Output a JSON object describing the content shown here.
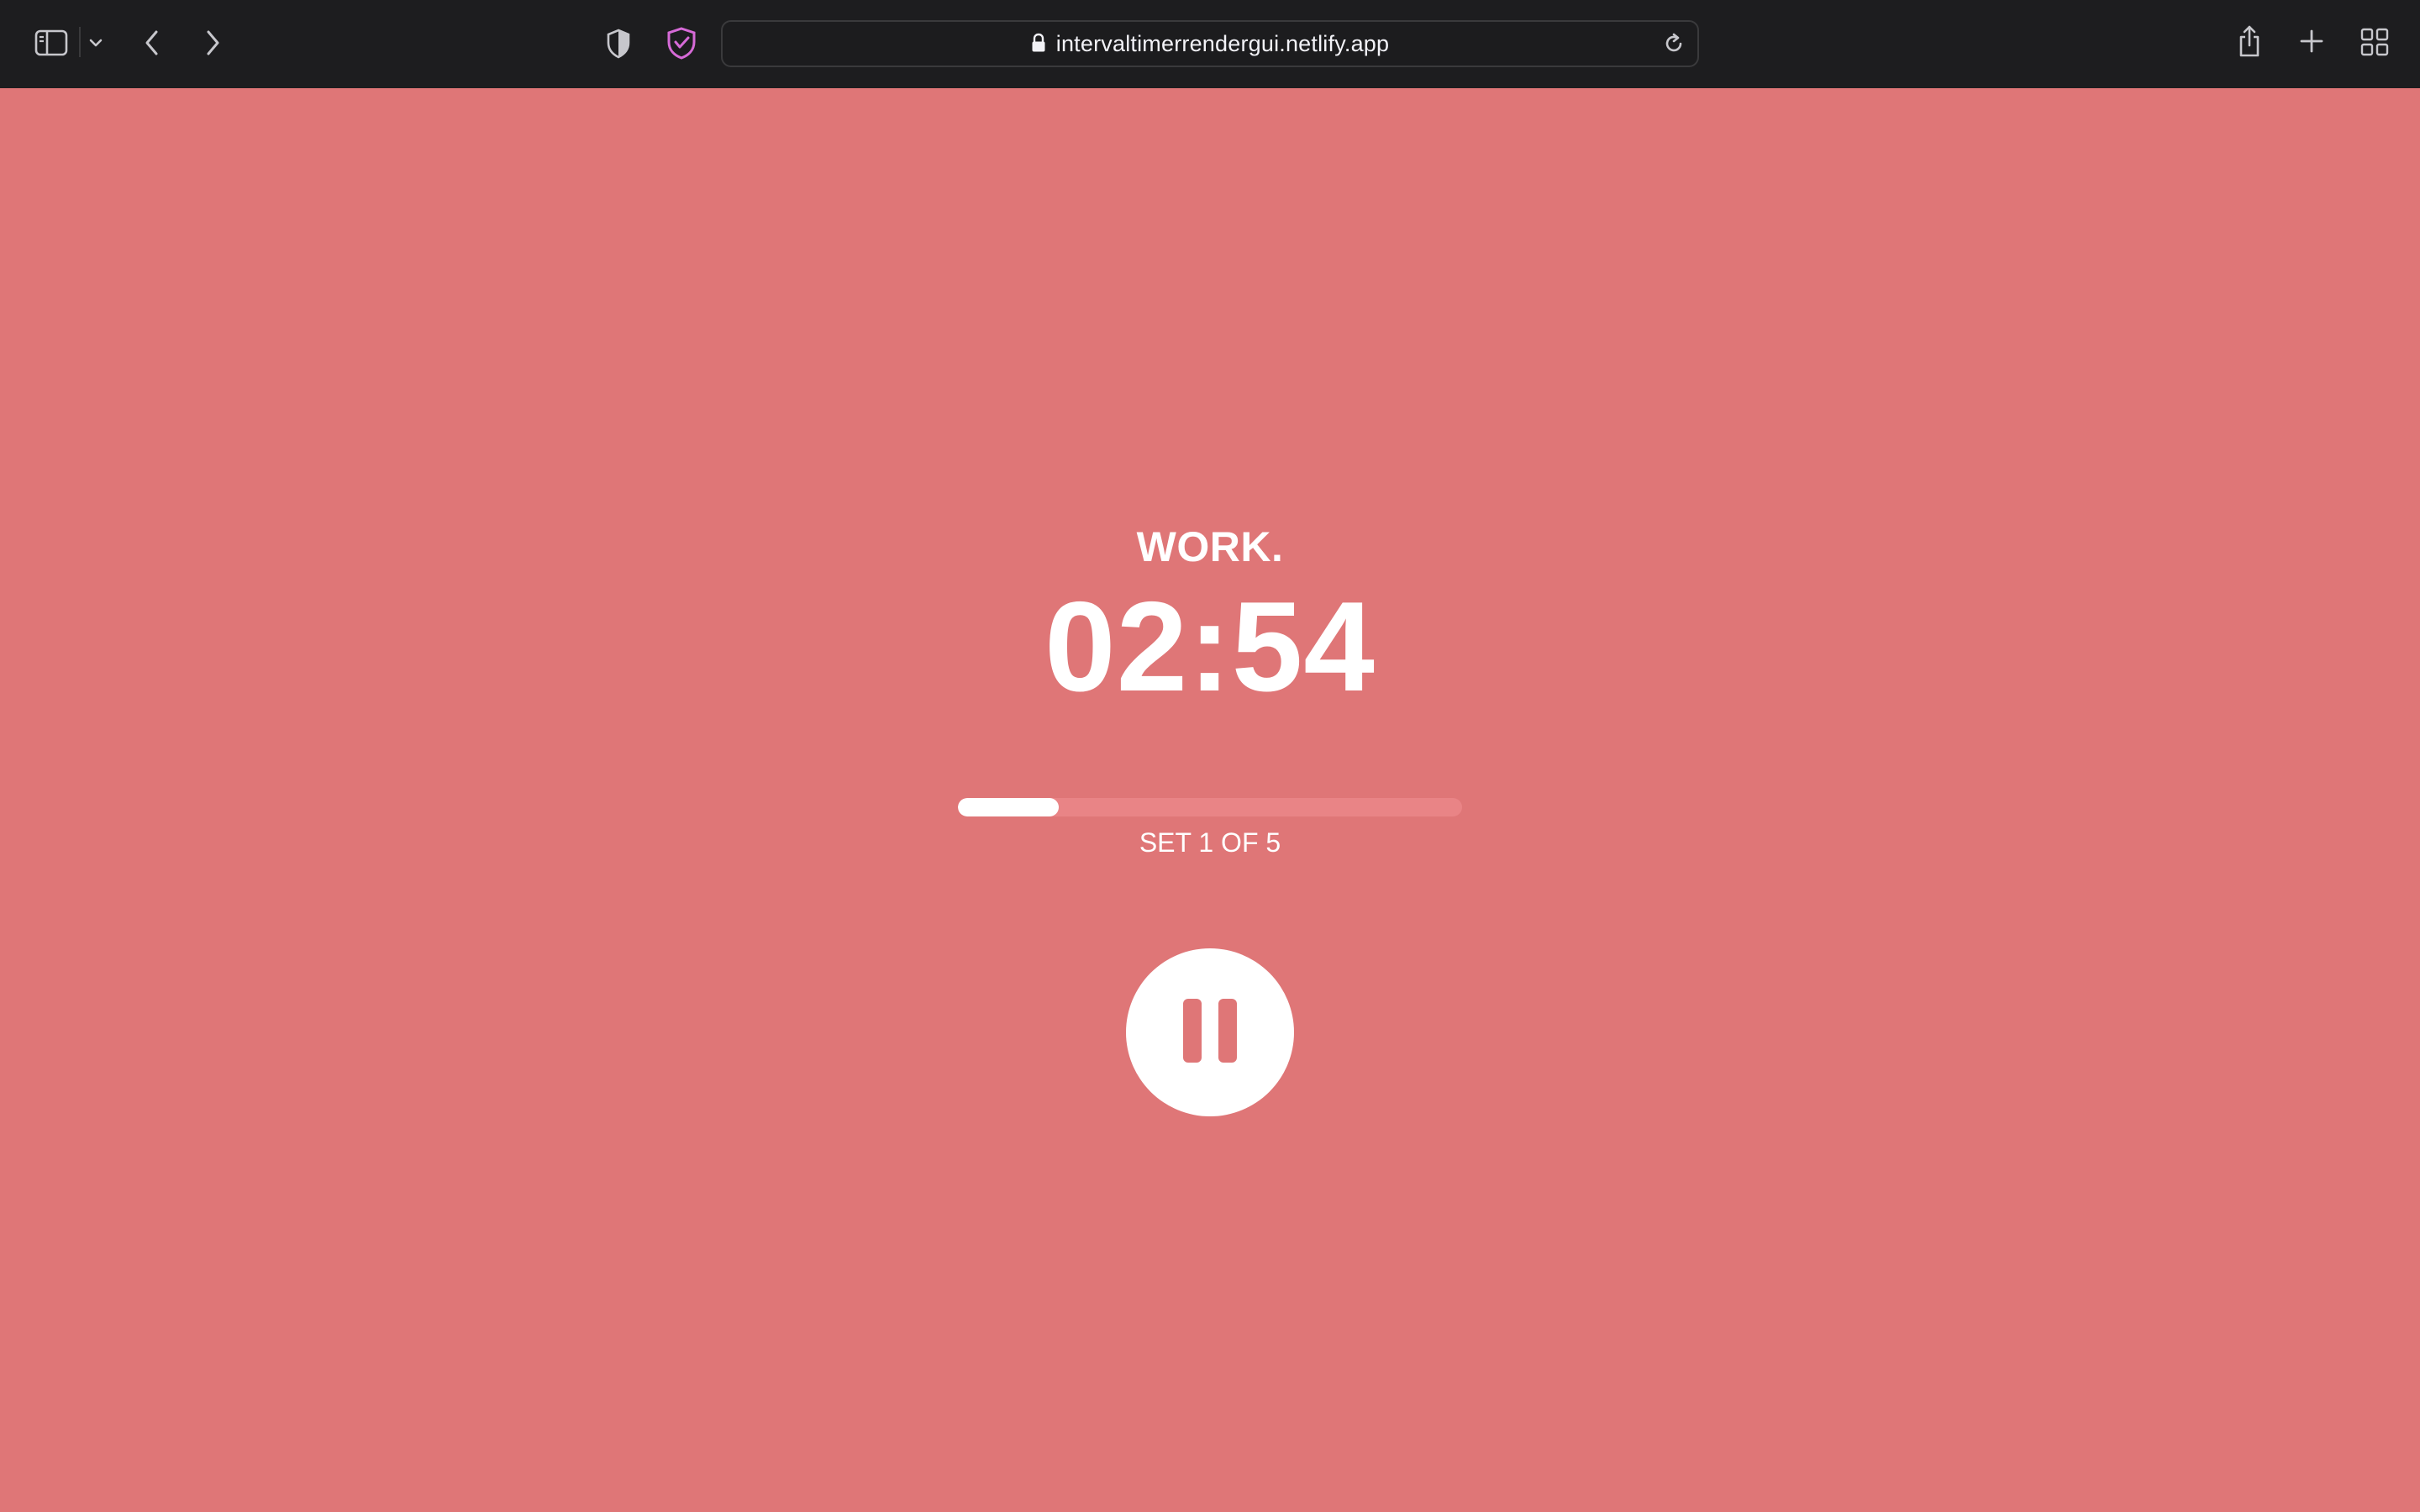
{
  "browser": {
    "url": "intervaltimerrendergui.netlify.app"
  },
  "timer": {
    "phase": "WORK.",
    "time_remaining": "02:54",
    "set_text": "SET 1 OF 5",
    "progress_fraction": 0.2
  },
  "colors": {
    "background": "#df7677",
    "progress_track": "#e98486",
    "toolbar": "#1d1d1f",
    "foreground": "#ffffff"
  },
  "icons": {
    "sidebar": "sidebar-icon",
    "tab_menu": "chevron-down-icon",
    "back": "chevron-left-icon",
    "forward": "chevron-right-icon",
    "privacy": "shield-half-icon",
    "extension": "shield-check-icon",
    "lock": "lock-icon",
    "reload": "reload-icon",
    "share": "share-icon",
    "new_tab": "plus-icon",
    "tab_overview": "grid-icon",
    "pause": "pause-icon"
  }
}
